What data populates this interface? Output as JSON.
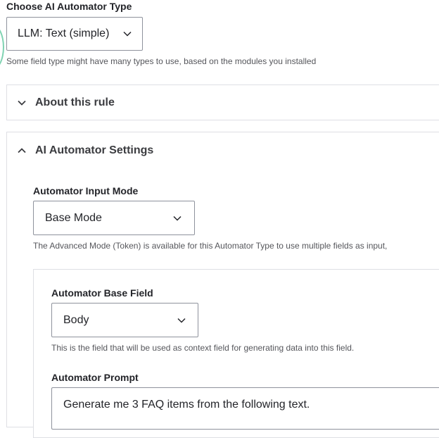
{
  "automator_type": {
    "label": "Choose AI Automator Type",
    "selected": "LLM: Text (simple)",
    "description": "Some field type might have many types to use, based on the modules you installed"
  },
  "about_rule": {
    "summary": "About this rule",
    "state": "collapsed"
  },
  "automator_settings": {
    "summary": "AI Automator Settings",
    "state": "expanded",
    "input_mode": {
      "label": "Automator Input Mode",
      "selected": "Base Mode",
      "description": "The Advanced Mode (Token) is available for this Automator Type to use multiple fields as input,"
    },
    "base_field": {
      "label": "Automator Base Field",
      "selected": "Body",
      "description": "This is the field that will be used as context field for generating data into this field."
    },
    "prompt": {
      "label": "Automator Prompt",
      "line1": "Generate me 3 FAQ items from the following text."
    }
  },
  "icons": {
    "select_arrow": "chevron-down-icon",
    "collapsed_summary": "chevron-down-icon",
    "expanded_summary": "chevron-up-icon"
  },
  "colors": {
    "text": "#232429",
    "border": "#8e929c",
    "panel_border": "#dedfe4",
    "focus": "#7fd3b2"
  }
}
